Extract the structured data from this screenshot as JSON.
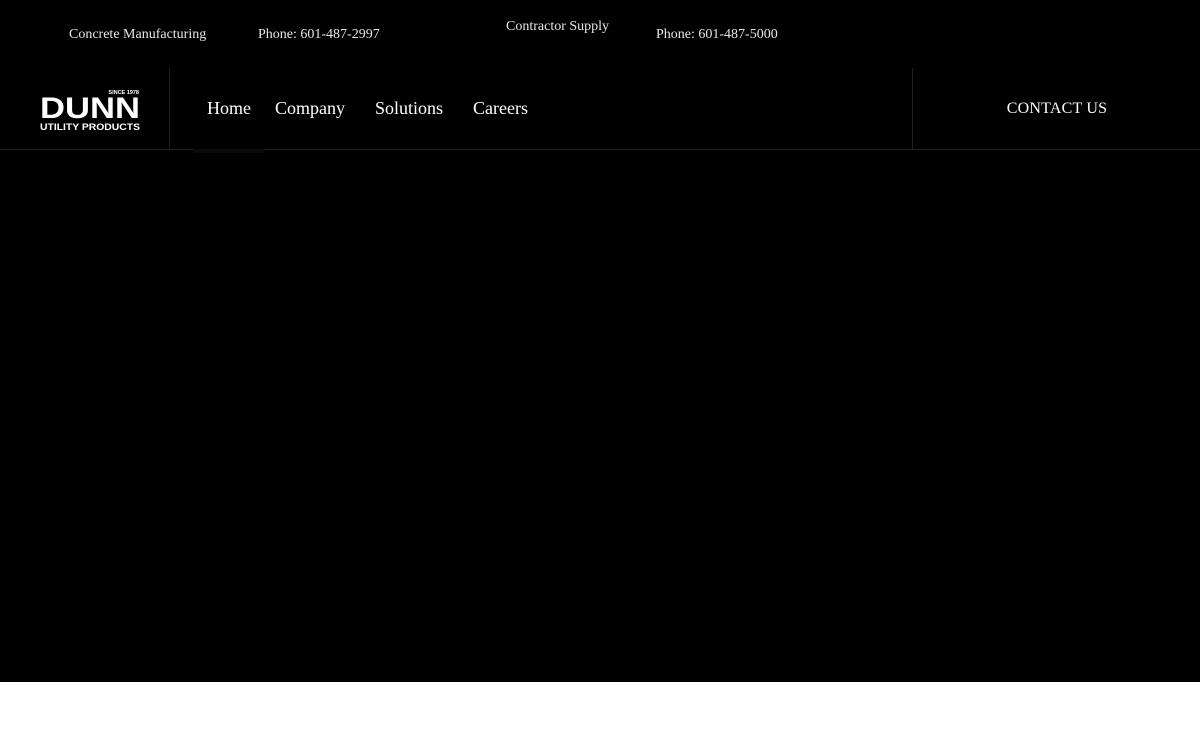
{
  "topbar": {
    "concrete": "Concrete Manufacturing",
    "phone1": "Phone: 601-487-2997",
    "contractor": "Contractor Supply",
    "phone2": "Phone: 601-487-5000"
  },
  "logo": {
    "since": "SINCE 1978",
    "brand": "DUNN",
    "tagline": "UTILITY PRODUCTS"
  },
  "nav": {
    "items": [
      {
        "label": "Home"
      },
      {
        "label": "Company"
      },
      {
        "label": "Solutions"
      },
      {
        "label": "Careers"
      }
    ],
    "active": "Home",
    "contact": "CONTACT US"
  },
  "colors": {
    "hero_background": "#000000",
    "text": "#ffffff",
    "divider": "#1f1f1f"
  }
}
